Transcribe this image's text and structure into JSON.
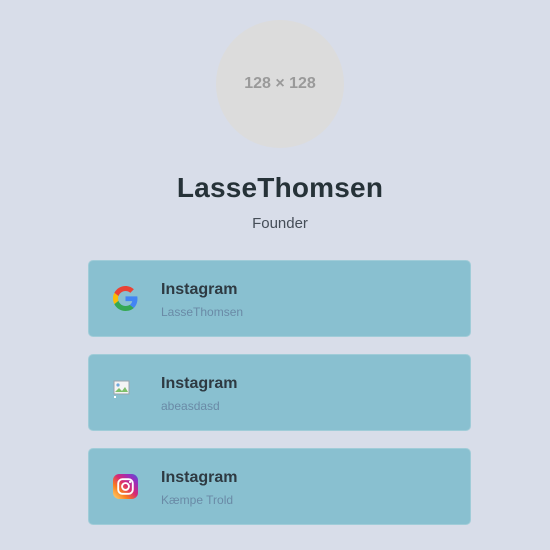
{
  "profile": {
    "avatar_placeholder": "128 × 128",
    "name": "LasseThomsen",
    "role": "Founder"
  },
  "links": [
    {
      "title": "Instagram",
      "subtitle": "LasseThomsen",
      "icon": "google-icon"
    },
    {
      "title": "Instagram",
      "subtitle": "abeasdasd",
      "icon": "broken-image-icon"
    },
    {
      "title": "Instagram",
      "subtitle": "Kæmpe Trold",
      "icon": "instagram-icon"
    }
  ],
  "colors": {
    "background": "#d8dde9",
    "card": "#89c0d0",
    "avatar": "#dcdcdc"
  }
}
